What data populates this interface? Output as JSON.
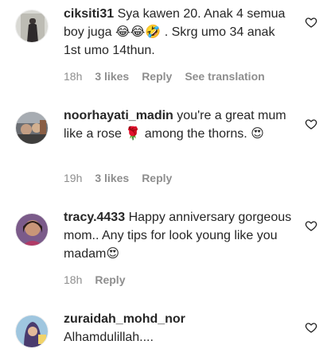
{
  "comments": [
    {
      "username": "ciksiti31",
      "text": "Sya kawen 20. Anak 4 semua boy juga 😂😂🤣 . Skrg umo 34 anak 1st umo 14thun.",
      "time": "18h",
      "likes": "3 likes",
      "reply": "Reply",
      "translate": "See translation"
    },
    {
      "username": "noorhayati_madin",
      "text": "you're a great mum like a rose 🌹 among the thorns. 😍",
      "time": "19h",
      "likes": "3 likes",
      "reply": "Reply"
    },
    {
      "username": "tracy.4433",
      "text": "Happy anniversary gorgeous mom.. Any tips for look young like you madam😍",
      "time": "18h",
      "reply": "Reply"
    },
    {
      "username": "zuraidah_mohd_nor",
      "text": "Alhamdulillah....",
      "time": "",
      "reply": ""
    }
  ],
  "icons": {
    "like": "heart-outline-icon"
  },
  "colors": {
    "text": "#262626",
    "secondary": "#8e8e8e"
  }
}
